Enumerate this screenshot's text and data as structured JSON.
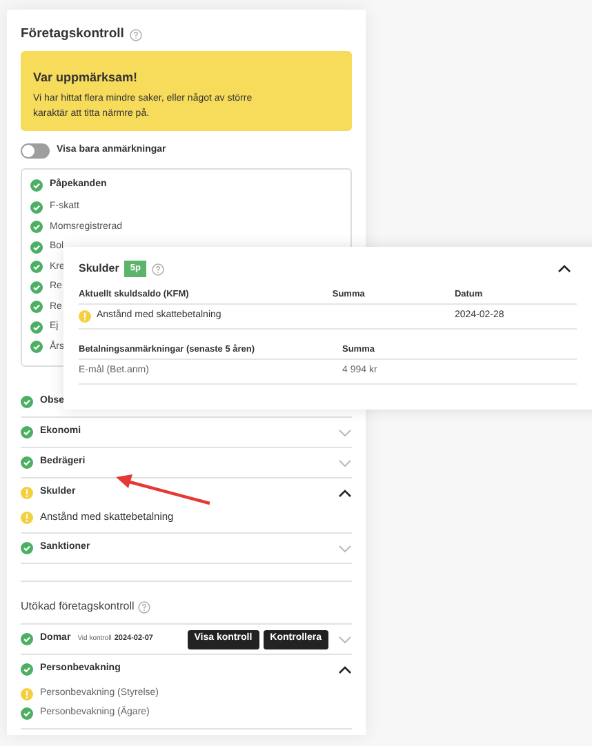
{
  "company_check": {
    "title": "Företagskontroll",
    "alert": {
      "title": "Var uppmärksam!",
      "text": "Vi har hittat flera mindre saker, eller något av större karaktär att titta närmre på."
    },
    "toggle": {
      "label": "Visa bara anmärkningar",
      "on": false
    },
    "remarks": {
      "title": "Påpekanden",
      "warning": false,
      "items": [
        {
          "label": "F-skatt",
          "warning": false
        },
        {
          "label": "Momsregistrerad",
          "warning": false
        },
        {
          "label": "Bol",
          "warning": false
        },
        {
          "label": "Kre",
          "warning": false
        },
        {
          "label": "Re",
          "warning": false
        },
        {
          "label": "Re",
          "warning": false
        },
        {
          "label": "Ej",
          "warning": false
        },
        {
          "label": "Års",
          "warning": false
        }
      ]
    },
    "sections": [
      {
        "label": "Obse",
        "warning": false
      },
      {
        "label": "Ekonomi",
        "warning": false,
        "expanded": false
      },
      {
        "label": "Bedrägeri",
        "warning": false,
        "expanded": false
      },
      {
        "label": "Skulder",
        "warning": true,
        "expanded": true,
        "items": [
          {
            "label": "Anstånd med skattebetalning",
            "warning": true
          }
        ]
      },
      {
        "label": "Sanktioner",
        "warning": false,
        "expanded": false
      }
    ]
  },
  "extended_check": {
    "title": "Utökad företagskontroll",
    "sections": [
      {
        "label": "Domar",
        "warning": false,
        "expanded": false,
        "note_label": "Vid kontroll",
        "note_date": "2024-02-07",
        "buttons": [
          "Visa kontroll",
          "Kontrollera"
        ]
      },
      {
        "label": "Personbevakning",
        "warning": false,
        "expanded": true,
        "items": [
          {
            "label": "Personbevakning (Styrelse)",
            "warning": true
          },
          {
            "label": "Personbevakning (Ägare)",
            "warning": false
          }
        ]
      }
    ]
  },
  "debts_popup": {
    "title": "Skulder",
    "badge": "5p",
    "expanded": true,
    "tables": [
      {
        "columns": [
          "Aktuellt skuldsaldo (KFM)",
          "Summa",
          "Datum"
        ],
        "rows": [
          {
            "warning": true,
            "cells": [
              "Anstånd med skattebetalning",
              null,
              "2024-02-28"
            ]
          }
        ]
      },
      {
        "columns": [
          "Betalningsanmärkningar (senaste 5 åren)",
          "Summa"
        ],
        "rows": [
          {
            "cells": [
              "E-mål (Bet.anm)",
              "4 994 kr"
            ]
          }
        ]
      }
    ]
  }
}
